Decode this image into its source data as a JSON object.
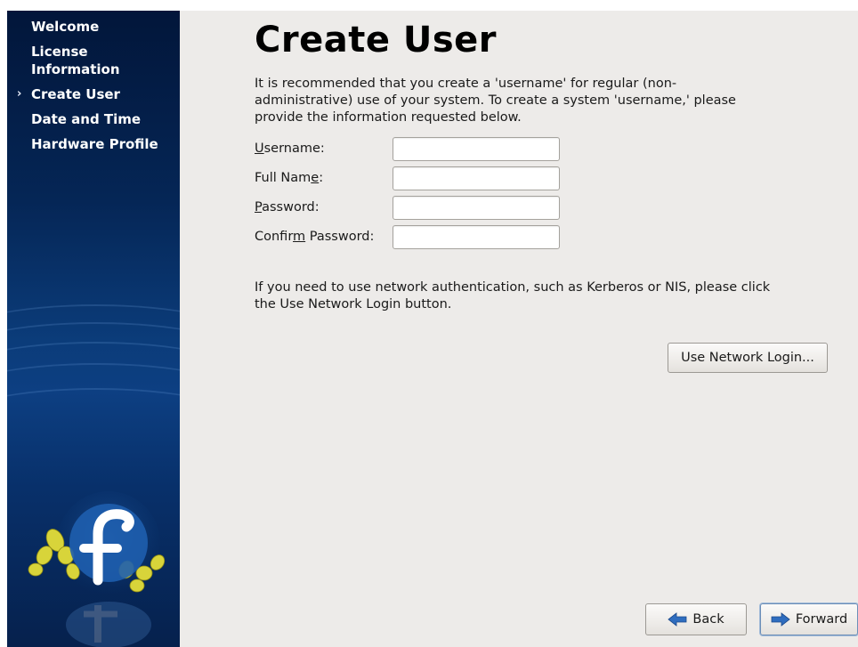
{
  "sidebar": {
    "steps": [
      {
        "label": "Welcome",
        "current": false
      },
      {
        "label": "License Information",
        "current": false
      },
      {
        "label": "Create User",
        "current": true
      },
      {
        "label": "Date and Time",
        "current": false
      },
      {
        "label": "Hardware Profile",
        "current": false
      }
    ],
    "current_marker": "›",
    "logo_icon": "fedora-logo-icon"
  },
  "main": {
    "title": "Create User",
    "intro": "It is recommended that you create a 'username' for regular (non-administrative) use of your system. To create a system 'username,' please provide the information requested below.",
    "fields": [
      {
        "label": "Username:",
        "mnemonic": "U",
        "value": ""
      },
      {
        "label": "Full Name:",
        "mnemonic": "e",
        "value": ""
      },
      {
        "label": "Password:",
        "mnemonic": "P",
        "value": ""
      },
      {
        "label": "Confirm Password:",
        "mnemonic": "m",
        "value": ""
      }
    ],
    "network_text": "If you need to use network authentication, such as Kerberos or NIS, please click the Use Network Login button.",
    "network_button": "Use Network Login..."
  },
  "nav": {
    "back_label": "Back",
    "forward_label": "Forward",
    "back_icon": "arrow-left-icon",
    "forward_icon": "arrow-right-icon"
  },
  "colors": {
    "sidebar_dark": "#02163a",
    "sidebar_mid": "#0d3f82",
    "content_bg": "#edebe9",
    "arrow_blue": "#2f6dbf",
    "logo_yellow": "#d8d43a"
  }
}
